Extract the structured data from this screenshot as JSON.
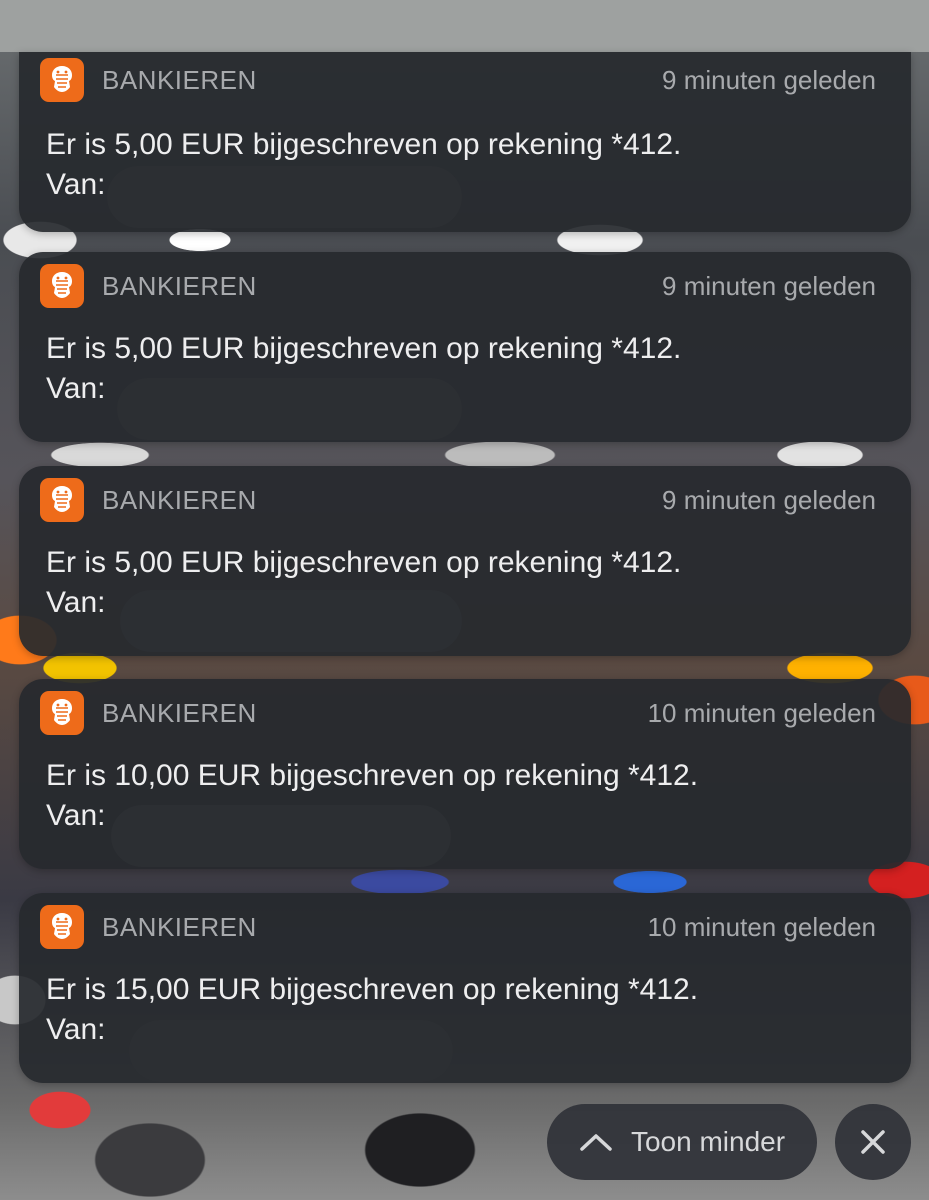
{
  "colors": {
    "accent": "#ee6b1a",
    "card": "#26292e",
    "text_primary": "#eeeeef",
    "text_secondary": "#a8aaad"
  },
  "notifications": [
    {
      "app": "BANKIEREN",
      "icon": "ing-lion-icon",
      "time": "9 minuten geleden",
      "message": "Er is 5,00 EUR bijgeschreven op rekening *412.",
      "from_label": "Van:"
    },
    {
      "app": "BANKIEREN",
      "icon": "ing-lion-icon",
      "time": "9 minuten geleden",
      "message": "Er is 5,00 EUR bijgeschreven op rekening *412.",
      "from_label": "Van:"
    },
    {
      "app": "BANKIEREN",
      "icon": "ing-lion-icon",
      "time": "9 minuten geleden",
      "message": "Er is 5,00 EUR bijgeschreven op rekening *412.",
      "from_label": "Van:"
    },
    {
      "app": "BANKIEREN",
      "icon": "ing-lion-icon",
      "time": "10 minuten geleden",
      "message": "Er is 10,00 EUR bijgeschreven op rekening *412.",
      "from_label": "Van:"
    },
    {
      "app": "BANKIEREN",
      "icon": "ing-lion-icon",
      "time": "10 minuten geleden",
      "message": "Er is 15,00 EUR bijgeschreven op rekening *412.",
      "from_label": "Van:"
    }
  ],
  "controls": {
    "show_less_label": "Toon minder",
    "show_less_icon": "chevron-up-icon",
    "close_icon": "close-icon"
  }
}
